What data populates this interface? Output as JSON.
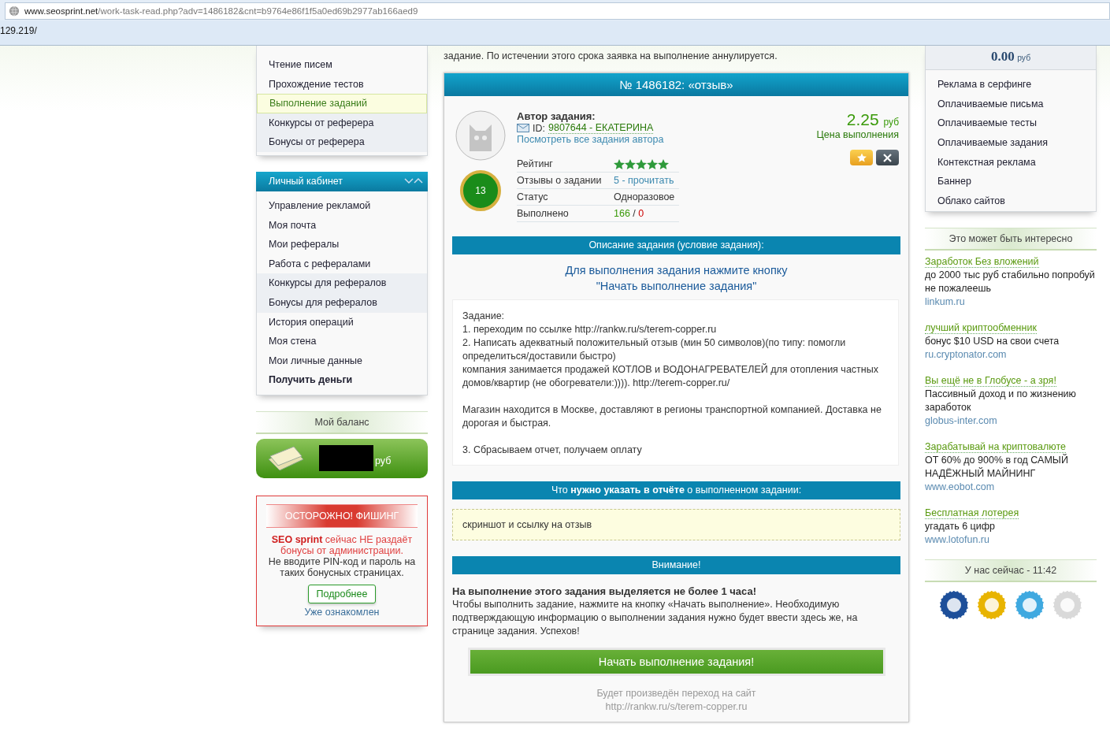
{
  "browser": {
    "url_domain": "www.seosprint.net",
    "url_path": "/work-task-read.php?adv=1486182&cnt=b9764e86f1f5a0ed69b2977ab166aed9",
    "suggestion": "129.219/"
  },
  "left_menu": {
    "items": [
      {
        "label": "Чтение писем",
        "selected": false,
        "shaded": false
      },
      {
        "label": "Прохождение тестов",
        "selected": false,
        "shaded": false
      },
      {
        "label": "Выполнение заданий",
        "selected": true,
        "shaded": false
      },
      {
        "label": "Конкурсы от реферера",
        "selected": false,
        "shaded": true
      },
      {
        "label": "Бонусы от реферера",
        "selected": false,
        "shaded": true
      }
    ]
  },
  "cabinet": {
    "title": "Личный кабинет",
    "items": [
      {
        "label": "Управление рекламой",
        "bold": false,
        "shaded": false
      },
      {
        "label": "Моя почта",
        "bold": false,
        "shaded": false
      },
      {
        "label": "Мои рефералы",
        "bold": false,
        "shaded": false
      },
      {
        "label": "Работа с рефералами",
        "bold": false,
        "shaded": false
      },
      {
        "label": "Конкурсы для рефералов",
        "bold": false,
        "shaded": true
      },
      {
        "label": "Бонусы для рефералов",
        "bold": false,
        "shaded": true
      },
      {
        "label": "История операций",
        "bold": false,
        "shaded": false
      },
      {
        "label": "Моя стена",
        "bold": false,
        "shaded": false
      },
      {
        "label": "Мои личные данные",
        "bold": false,
        "shaded": false
      },
      {
        "label": "Получить деньги",
        "bold": true,
        "shaded": false
      }
    ]
  },
  "balance": {
    "title": "Мой баланс",
    "currency": "руб"
  },
  "phishing": {
    "title": "ОСТОРОЖНО! ФИШИНГ",
    "message": "**SEO sprint** сейчас НЕ раздаёт бонусы от администрации.",
    "note": "Не вводите PIN-код и пароль на таких бонусных страницах.",
    "button": "Подробнее",
    "dismiss": "Уже ознакомлен"
  },
  "task": {
    "notice": "задание. По истечении этого срока заявка на выполнение аннулируется.",
    "title": "№ 1486182: «отзыв»",
    "author_label": "Автор задания:",
    "author_id_label": "ID:",
    "author": "9807644 - ЕКАТЕРИНА",
    "author_tasks_link": "Посмотреть все задания автора",
    "level_badge": "13",
    "price": "2.25",
    "price_currency": "руб",
    "price_label": "Цена выполнения",
    "stats": [
      {
        "label": "Рейтинг",
        "kind": "stars",
        "stars": 5
      },
      {
        "label": "Отзывы о задании",
        "kind": "link",
        "value": "5 - прочитать"
      },
      {
        "label": "Статус",
        "kind": "text",
        "value": "Одноразовое"
      },
      {
        "label": "Выполнено",
        "kind": "counts",
        "done": "166",
        "separator": "/",
        "failed": "0"
      }
    ],
    "description_header": "Описание задания (условие задания):",
    "instruction": [
      "Для выполнения задания нажмите кнопку",
      "\"Начать выполнение задания\""
    ],
    "description": [
      [
        "Задание:",
        "1. переходим по ссылке http://rankw.ru/s/terem-copper.ru",
        "2. Написать адекватный положительный отзыв (мин 50 символов)(по типу: помогли определиться/доставили быстро)",
        "компания занимается продажей КОТЛОВ и ВОДОНАГРЕВАТЕЛЕЙ для отопления частных домов/квартир (не обогреватели:)))). http://terem-copper.ru/"
      ],
      [
        "Магазин находится в Москве, доставляют в регионы транспортной компанией. Доставка не дорогая и быстрая."
      ],
      [
        "3. Сбрасываем отчет, получаем оплату"
      ]
    ],
    "report_header": "Что **нужно указать в отчёте** о выполненном задании:",
    "report": "скриншот и ссылку на отзыв",
    "attention_header": "Внимание!",
    "attention_title": "На выполнение этого задания выделяется не более 1 часа!",
    "attention_text": "Чтобы выполнить задание, нажмите на кнопку «Начать выполнение». Необходимую подтверждающую информацию о выполнении задания нужно будет ввести здесь же, на странице задания. Успехов!",
    "start_button": "Начать выполнение задания!",
    "redirect_note": "Будет произведён переход на сайт",
    "redirect_url": "http://rankw.ru/s/terem-copper.ru"
  },
  "ad_balance": {
    "amount": "0.00",
    "currency": "руб"
  },
  "ad_links": [
    "Реклама в серфинге",
    "Оплачиваемые письма",
    "Оплачиваемые тесты",
    "Оплачиваемые задания",
    "Контекстная реклама",
    "Баннер",
    "Облако сайтов"
  ],
  "interesting": {
    "title": "Это может быть интересно",
    "ads": [
      {
        "title": "Заработок Без вложений",
        "text": "до 2000 тыс руб стабильно попробуй не пожалеешь",
        "domain": "linkum.ru"
      },
      {
        "title": "лучший криптообменник",
        "text": "бонус $10 USD на свои счета",
        "domain": "ru.cryptonator.com"
      },
      {
        "title": "Вы ещё не в Глобусе - а зря!",
        "text": "Пассивный доход и по жизнению заработок",
        "domain": "globus-inter.com"
      },
      {
        "title": "Зарабатывай на криптовалюте",
        "text": "ОТ 60% до 900% в год САМЫЙ НАДЁЖНЫЙ МАЙНИНГ",
        "domain": "www.eobot.com"
      },
      {
        "title": "Бесплатная лотерея",
        "text": "угадать 6 цифр",
        "domain": "www.lotofun.ru"
      }
    ]
  },
  "clock": "У нас сейчас - 11:42"
}
